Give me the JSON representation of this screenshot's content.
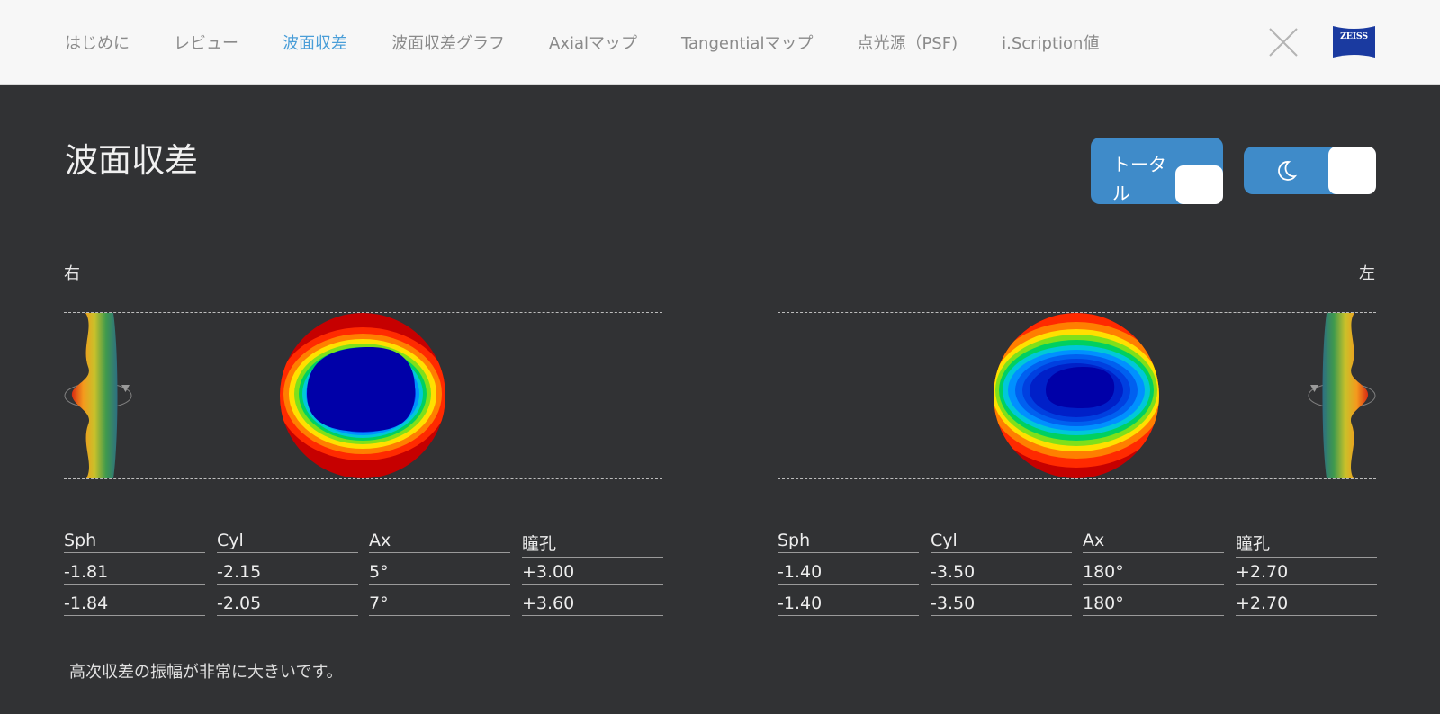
{
  "nav": {
    "items": [
      {
        "label": "はじめに"
      },
      {
        "label": "レビュー"
      },
      {
        "label": "波面収差"
      },
      {
        "label": "波面収差グラフ"
      },
      {
        "label": "Axialマップ"
      },
      {
        "label": "Tangentialマップ"
      },
      {
        "label": "点光源（PSF)"
      },
      {
        "label": "i.Scription値"
      }
    ],
    "active_index": 2,
    "close_icon": "close-x-icon",
    "logo_text": "ZEISS"
  },
  "page": {
    "title": "波面収差",
    "toggle_total_label": "トータル",
    "toggle_night_icon": "moon-icon"
  },
  "right_eye": {
    "label": "右",
    "headers": [
      "Sph",
      "Cyl",
      "Ax",
      "瞳孔"
    ],
    "rows": [
      [
        "-1.81",
        "-2.15",
        "5°",
        "+3.00"
      ],
      [
        "-1.84",
        "-2.05",
        "7°",
        "+3.60"
      ]
    ]
  },
  "left_eye": {
    "label": "左",
    "headers": [
      "Sph",
      "Cyl",
      "Ax",
      "瞳孔"
    ],
    "rows": [
      [
        "-1.40",
        "-3.50",
        "180°",
        "+2.70"
      ],
      [
        "-1.40",
        "-3.50",
        "180°",
        "+2.70"
      ]
    ]
  },
  "note": "高次収差の振幅が非常に大きいです。",
  "colors": {
    "accent": "#4a9ed8",
    "toggle": "#3f8bc9",
    "background": "#313234",
    "logo": "#1a3aa0"
  }
}
